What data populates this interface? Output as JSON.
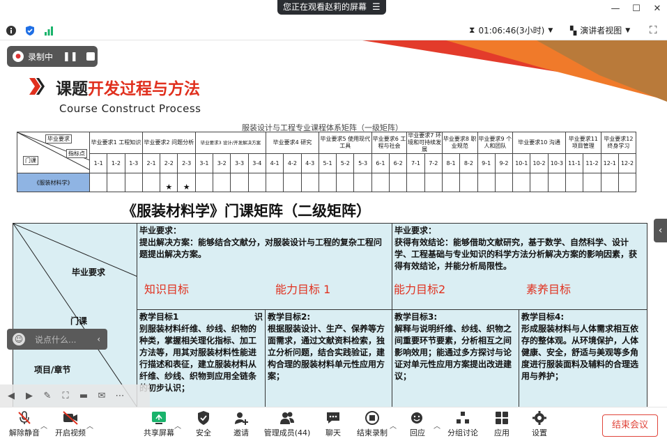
{
  "window": {
    "share_notice": "您正在观看赵莉的屏幕",
    "share_menu_icon": "hamburger-icon"
  },
  "infobar": {
    "timer": "01:06:46(3小时)",
    "view_mode": "演讲者视图"
  },
  "recording": {
    "label": "录制中"
  },
  "slide": {
    "title_black": "课题",
    "title_red": "开发过程与方法",
    "subtitle": "Course Construct Process",
    "matrix1": {
      "title": "服装设计与工程专业课程体系矩阵（一级矩阵）",
      "corner_top": "毕业要求",
      "corner_mid": "指标点",
      "corner_bottom": "门课",
      "groups": [
        {
          "label": "毕业要求1\n工程知识",
          "points": [
            "1-1",
            "1-2",
            "1-3"
          ]
        },
        {
          "label": "毕业要求2\n问题分析",
          "points": [
            "2-1",
            "2-2",
            "2-3"
          ]
        },
        {
          "label": "毕业要求3\n设计/开发解决方案",
          "points": [
            "3-1",
            "3-2",
            "3-3",
            "3-4"
          ]
        },
        {
          "label": "毕业要求4\n研究",
          "points": [
            "4-1",
            "4-2",
            "4-3"
          ]
        },
        {
          "label": "毕业要求5\n使用现代工具",
          "points": [
            "5-1",
            "5-2",
            "5-3"
          ]
        },
        {
          "label": "毕业要求6\n工程与社会",
          "points": [
            "6-1",
            "6-2"
          ]
        },
        {
          "label": "毕业要求7\n环境和可持续发展",
          "points": [
            "7-1",
            "7-2"
          ]
        },
        {
          "label": "毕业要求8\n职业规范",
          "points": [
            "8-1",
            "8-2"
          ]
        },
        {
          "label": "毕业要求9\n个人和团队",
          "points": [
            "9-1",
            "9-2"
          ]
        },
        {
          "label": "毕业要求10\n沟通",
          "points": [
            "10-1",
            "10-2",
            "10-3"
          ]
        },
        {
          "label": "毕业要求11\n项目管理",
          "points": [
            "11-1",
            "11-2"
          ]
        },
        {
          "label": "毕业要求12\n终身学习",
          "points": [
            "12-1",
            "12-2"
          ]
        }
      ],
      "course": "《服装材料学》",
      "marked_points": [
        "2-2",
        "2-3"
      ],
      "mark": "★"
    },
    "matrix2": {
      "title": "《服装材料学》门课矩阵（二级矩阵）",
      "corner_labels": [
        "毕业要求",
        "门课",
        "项目/章节"
      ],
      "req_left": {
        "head": "毕业要求：",
        "body": "提出解决方案：能够结合文献分，对服装设计与工程的复杂工程问题提出解决方案。"
      },
      "req_right": {
        "head": "毕业要求：",
        "body": "获得有效结论：能够借助文献研究，基于数学、自然科学、设计学、工程基础与专业知识的科学方法分析解决方案的影响因素，获得有效结论，并能分析局限性。"
      },
      "goal_labels": [
        "知识目标",
        "能力目标 1",
        "能力目标2",
        "素养目标"
      ],
      "goals": [
        {
          "head": "教学目标1",
          "tail": "识",
          "body": "别服装材料纤维、纱线、织物的种类，掌握相关理化指标、加工方法等，用其对服装材料性能进行描述和表征，建立服装材料从纤维、纱线、织物到应用全链条的初步认识；"
        },
        {
          "head": "教学目标2:",
          "body": "根据服装设计、生产、保养等方面需求，通过文献资料检索，独立分析问题，结合实践验证，建构合理的服装材料单元性应用方案；"
        },
        {
          "head": "教学目标3:",
          "body": "解释与说明纤维、纱线、织物之间重要环节要素，分析相互之间影响效用；能通过多方探讨与论证对单元性应用方案提出改进建议；"
        },
        {
          "head": "教学目标4:",
          "body": "形成服装材料与人体需求相互依存的整体观。从环境保护，人体健康、安全，舒适与美观等多角度进行服装面料及辅料的合理选用与养护；"
        }
      ]
    }
  },
  "chat": {
    "placeholder": "说点什么..."
  },
  "toolbar": {
    "buttons": [
      {
        "label": "解除静音",
        "icon": "mic-muted-icon"
      },
      {
        "label": "开启视频",
        "icon": "camera-off-icon"
      },
      {
        "label": "共享屏幕",
        "icon": "share-screen-icon"
      },
      {
        "label": "安全",
        "icon": "shield-icon"
      },
      {
        "label": "邀请",
        "icon": "add-user-icon"
      },
      {
        "label": "管理成员(44)",
        "icon": "members-icon"
      },
      {
        "label": "聊天",
        "icon": "chat-icon"
      },
      {
        "label": "结束录制",
        "icon": "stop-record-icon"
      },
      {
        "label": "回应",
        "icon": "reaction-icon"
      },
      {
        "label": "分组讨论",
        "icon": "breakout-icon"
      },
      {
        "label": "应用",
        "icon": "apps-icon"
      },
      {
        "label": "设置",
        "icon": "settings-icon"
      }
    ],
    "end_meeting": "结束会议"
  },
  "colors": {
    "accent_red": "#e0301e",
    "table_fill": "#daeef3",
    "course_fill": "#8fb4e3",
    "dark_bar": "#2a2d31",
    "green_signal": "#19b36b",
    "blue_shield": "#1f6fe5"
  }
}
